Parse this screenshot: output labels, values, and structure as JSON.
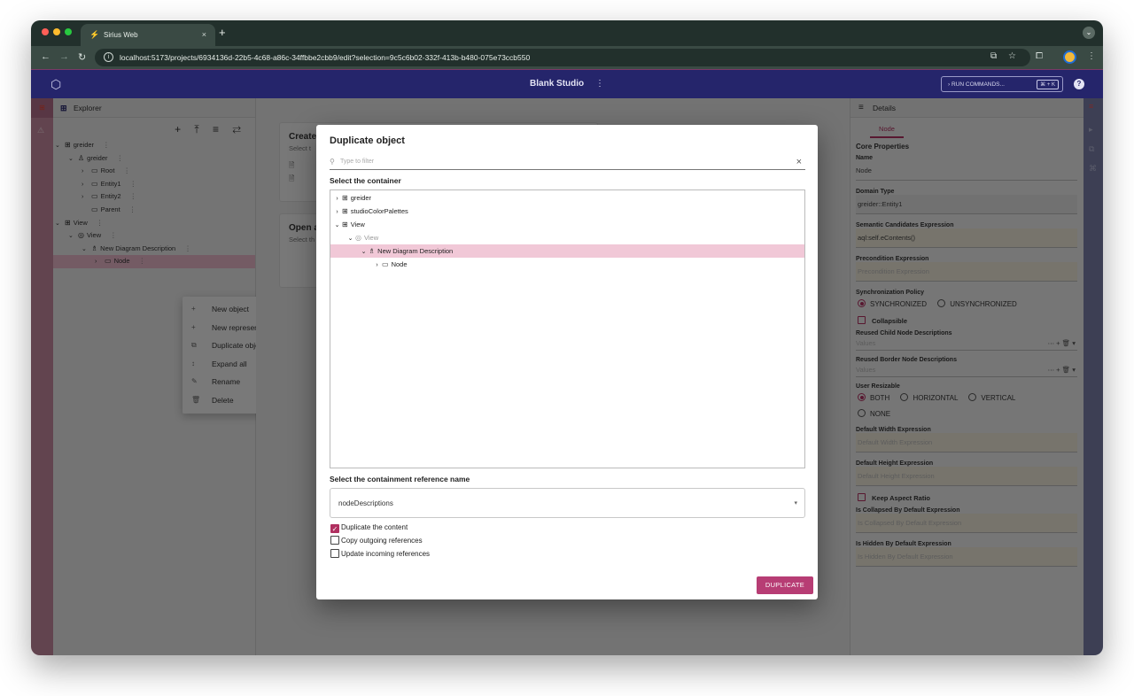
{
  "browser": {
    "tab_title": "Sirius Web",
    "tab_close": "×",
    "new_tab": "+",
    "url": "localhost:5173/projects/6934136d-22b5-4c68-a86c-34ffbbe2cbb9/edit?selection=9c5c6b02-332f-413b-b480-075e73ccb550"
  },
  "app": {
    "title": "Blank Studio",
    "more": "⋮",
    "run_commands": "RUN COMMANDS...",
    "run_shortcut": "⌘ + K",
    "help": "?"
  },
  "explorer": {
    "title": "Explorer",
    "tools": "+ ⤒ ≡ ⇄",
    "tree": [
      {
        "label": "greider",
        "chev": "⌄",
        "icon": "⊞",
        "depth": 0
      },
      {
        "label": "greider",
        "chev": "⌄",
        "icon": "♙",
        "depth": 1
      },
      {
        "label": "Root",
        "chev": "›",
        "icon": "▭",
        "depth": 2
      },
      {
        "label": "Entity1",
        "chev": "›",
        "icon": "▭",
        "depth": 2
      },
      {
        "label": "Entity2",
        "chev": "›",
        "icon": "▭",
        "depth": 2
      },
      {
        "label": "Parent",
        "chev": "",
        "icon": "▭",
        "depth": 2
      },
      {
        "label": "View",
        "chev": "⌄",
        "icon": "⊞",
        "depth": 0
      },
      {
        "label": "View",
        "chev": "⌄",
        "icon": "◎",
        "depth": 1
      },
      {
        "label": "New Diagram Description",
        "chev": "⌄",
        "icon": "♗",
        "depth": 2
      },
      {
        "label": "Node",
        "chev": "›",
        "icon": "▭",
        "depth": 3,
        "selected": true
      }
    ],
    "context_menu": [
      {
        "label": "New object",
        "icon": "+"
      },
      {
        "label": "New representation",
        "icon": "+"
      },
      {
        "label": "Duplicate object",
        "icon": "⧉"
      },
      {
        "label": "Expand all",
        "icon": "↕"
      },
      {
        "label": "Rename",
        "icon": "✎"
      },
      {
        "label": "Delete",
        "icon": "🗑"
      }
    ]
  },
  "center": {
    "create_title": "Create",
    "create_sub": "Select t",
    "open_title": "Open a",
    "open_sub": "Select th"
  },
  "dialog": {
    "title": "Duplicate object",
    "filter_placeholder": "Type to filter",
    "filter_clear": "×",
    "container_label": "Select the container",
    "tree": [
      {
        "label": "greider",
        "chev": "›",
        "icon": "⊞",
        "depth": 0
      },
      {
        "label": "studioColorPalettes",
        "chev": "›",
        "icon": "⊞",
        "depth": 0
      },
      {
        "label": "View",
        "chev": "⌄",
        "icon": "⊞",
        "depth": 0
      },
      {
        "label": "View",
        "chev": "⌄",
        "icon": "◎",
        "depth": 1,
        "muted": true
      },
      {
        "label": "New Diagram Description",
        "chev": "⌄",
        "icon": "♗",
        "depth": 2,
        "selected": true
      },
      {
        "label": "Node",
        "chev": "›",
        "icon": "▭",
        "depth": 3
      }
    ],
    "reference_label": "Select the containment reference name",
    "reference_value": "nodeDescriptions",
    "options": [
      {
        "label": "Duplicate the content",
        "checked": true
      },
      {
        "label": "Copy outgoing references",
        "checked": false
      },
      {
        "label": "Update incoming references",
        "checked": false
      }
    ],
    "submit": "DUPLICATE"
  },
  "details": {
    "title": "Details",
    "tab": "Node",
    "section": "Core Properties",
    "name_label": "Name",
    "name_value": "Node",
    "domain_label": "Domain Type",
    "domain_value": "greider::Entity1",
    "semantic_label": "Semantic Candidates Expression",
    "semantic_value": "aql:self.eContents()",
    "precondition_label": "Precondition Expression",
    "precondition_value": "Precondition Expression",
    "sync_label": "Synchronization Policy",
    "sync_options": [
      "SYNCHRONIZED",
      "UNSYNCHRONIZED"
    ],
    "collapsible": "Collapsible",
    "reused_child_label": "Reused Child Node Descriptions",
    "reused_child_value": "Values",
    "reused_border_label": "Reused Border Node Descriptions",
    "reused_border_value": "Values",
    "multi_tools": "⋯ + 🗑 ▾",
    "resizable_label": "User Resizable",
    "resizable_options": [
      "BOTH",
      "HORIZONTAL",
      "VERTICAL",
      "NONE"
    ],
    "width_label": "Default Width Expression",
    "width_value": "Default Width Expression",
    "height_label": "Default Height Expression",
    "height_value": "Default Height Expression",
    "keep_aspect": "Keep Aspect Ratio",
    "collapsed_label": "Is Collapsed By Default Expression",
    "collapsed_value": "Is Collapsed By Default Expression",
    "hidden_label": "Is Hidden By Default Expression",
    "hidden_value": "Is Hidden By Default Expression"
  },
  "colors": {
    "accent": "#b03060",
    "header": "#25256b",
    "chrome": "#22302c",
    "selection": "#f1c8d7"
  }
}
